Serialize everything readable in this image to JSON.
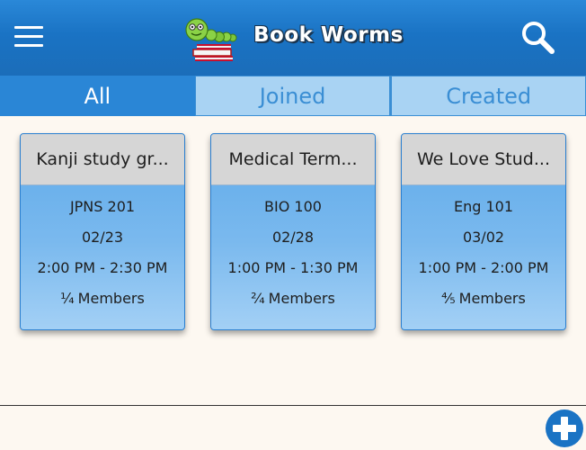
{
  "header": {
    "title": "Book Worms",
    "menu_icon": "hamburger-menu-icon",
    "logo_icon": "bookworm-logo",
    "search_icon": "search-icon",
    "bg_color": "#1a73c4"
  },
  "tabs": [
    {
      "label": "All",
      "active": true
    },
    {
      "label": "Joined",
      "active": false
    },
    {
      "label": "Created",
      "active": false
    }
  ],
  "groups": [
    {
      "title": "Kanji study gr...",
      "course": "JPNS 201",
      "date": "02/23",
      "time": "2:00 PM - 2:30 PM",
      "members_fraction": "¼",
      "members_label": "Members"
    },
    {
      "title": "Medical Term...",
      "course": "BIO 100",
      "date": "02/28",
      "time": "1:00 PM - 1:30 PM",
      "members_fraction": "²⁄₄",
      "members_label": "Members"
    },
    {
      "title": "We Love Stud...",
      "course": "Eng 101",
      "date": "03/02",
      "time": "1:00 PM - 2:00 PM",
      "members_fraction": "⁴⁄₅",
      "members_label": "Members"
    }
  ],
  "add_button": {
    "icon": "plus-circle-icon",
    "color": "#1a73c4"
  }
}
